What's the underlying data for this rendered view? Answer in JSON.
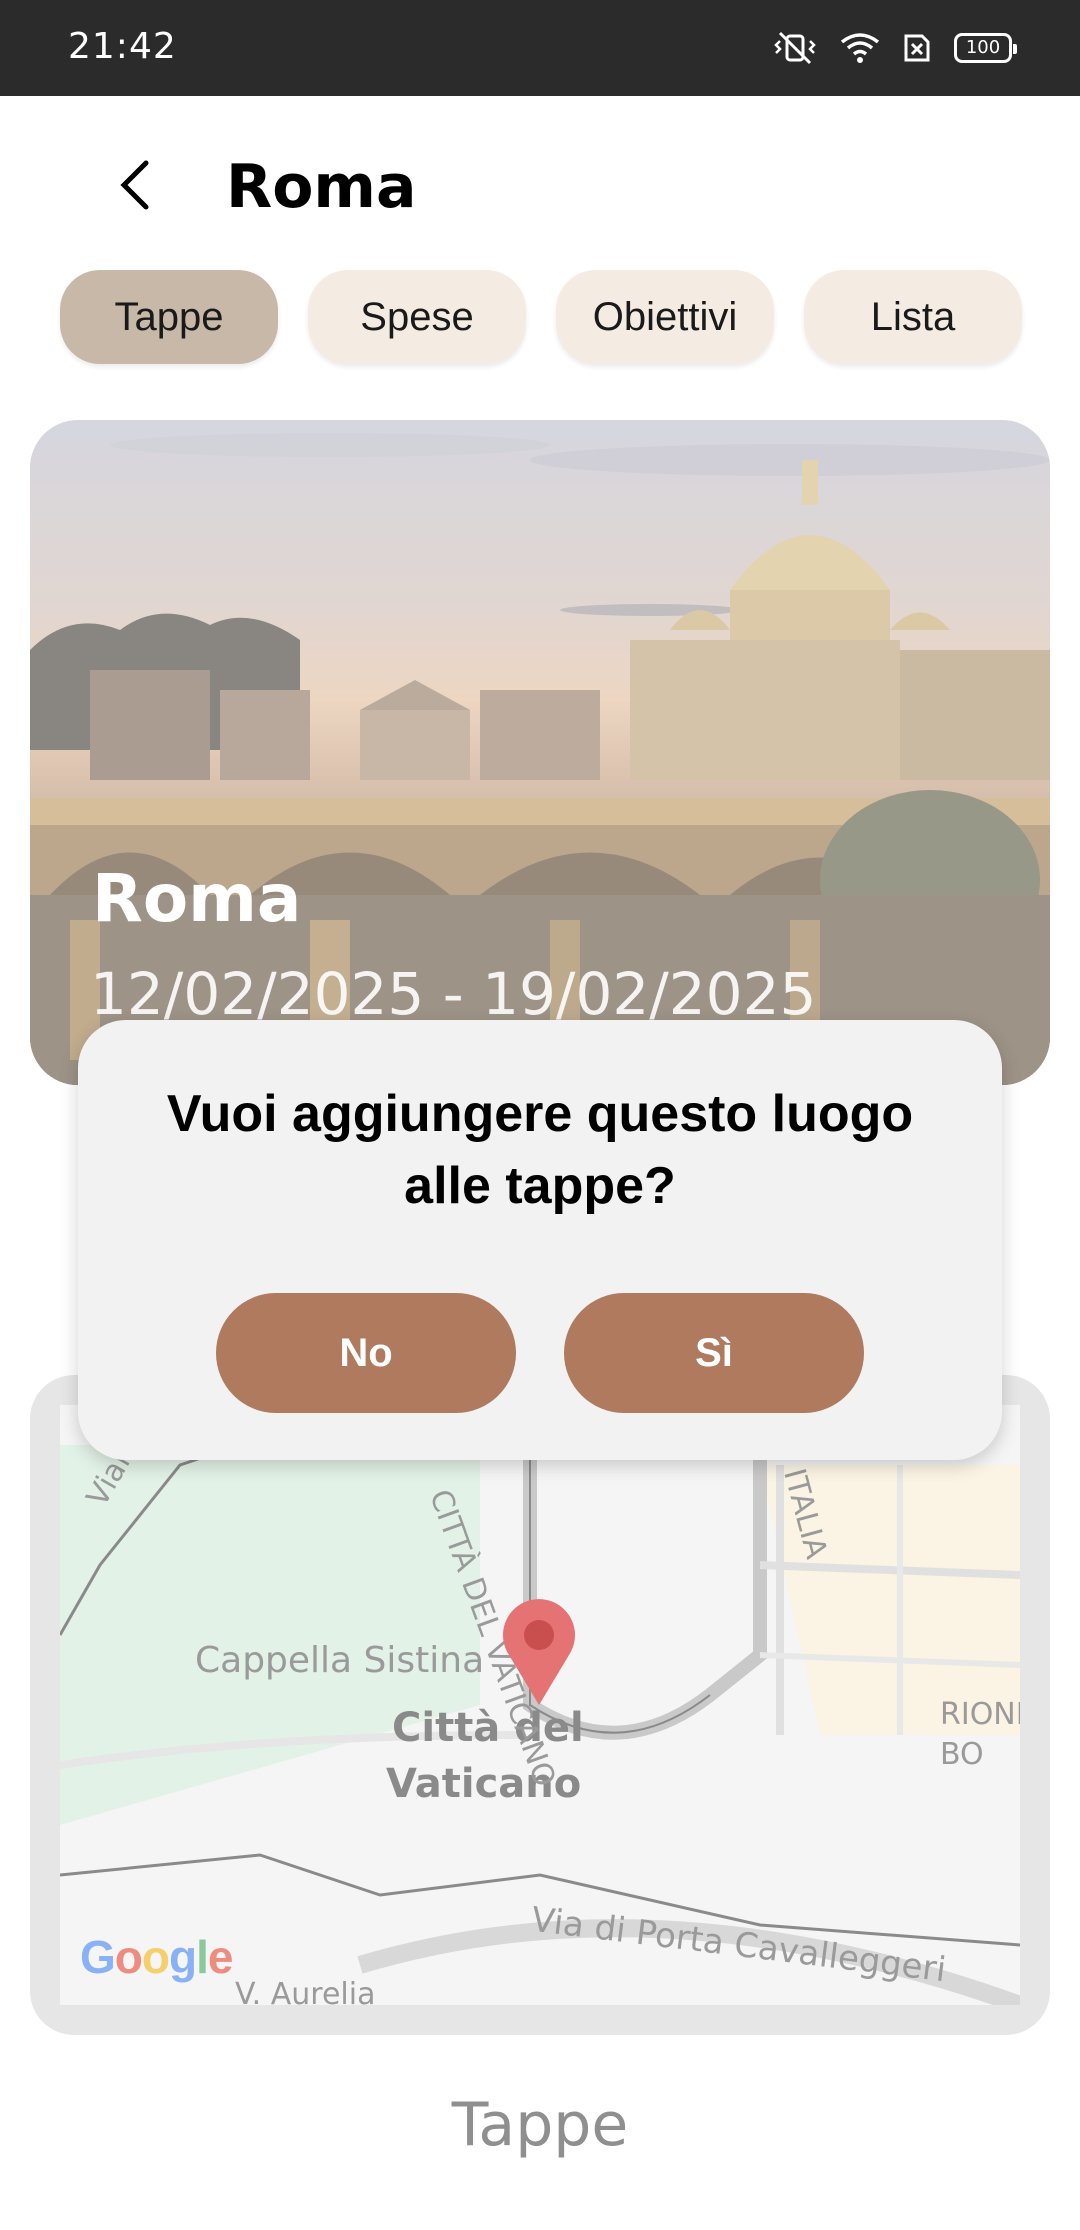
{
  "status_bar": {
    "time": "21:42",
    "battery": "100",
    "icons": [
      "vibrate-off-icon",
      "wifi-icon",
      "sim-x-icon",
      "battery-icon"
    ]
  },
  "header": {
    "back_icon": "chevron-left-icon",
    "title": "Roma"
  },
  "tabs": [
    {
      "label": "Tappe",
      "active": true
    },
    {
      "label": "Spese",
      "active": false
    },
    {
      "label": "Obiettivi",
      "active": false
    },
    {
      "label": "Lista",
      "active": false
    }
  ],
  "hero": {
    "title": "Roma",
    "dates": "12/02/2025 - 19/02/2025"
  },
  "map": {
    "labels": {
      "place1": "Cappella Sistina",
      "place2_line1": "Città del",
      "place2_line2": "Vaticano",
      "street1": "Viale Vaticano",
      "street2": "CITTÀ DEL VATICANO",
      "street3": "ITALIA",
      "street4": "Via di Porta Cavalleggeri",
      "street5": "V. Aurelia",
      "district": "RIONE BO"
    },
    "pin_icon": "map-pin-icon",
    "brand": [
      "G",
      "o",
      "o",
      "g",
      "l",
      "e"
    ]
  },
  "footer": {
    "section_title": "Tappe"
  },
  "dialog": {
    "message": "Vuoi aggiungere questo luogo alle tappe?",
    "no_label": "No",
    "yes_label": "Sì"
  },
  "colors": {
    "status_bar": "#2b2b2b",
    "tab_active": "#c8b8a8",
    "tab_inactive": "#f4ebe2",
    "dialog_button": "#b07a5f",
    "dialog_bg": "#f2f2f2",
    "pin": "#e57373"
  }
}
